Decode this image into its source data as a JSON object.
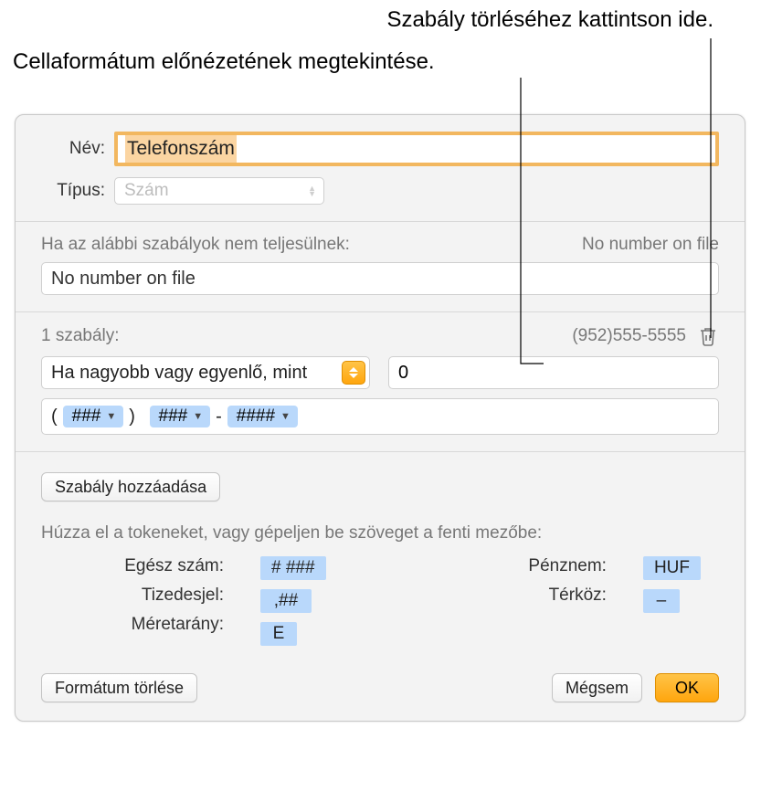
{
  "callouts": {
    "delete_rule": "Szabály törléséhez kattintson ide.",
    "preview": "Cellaformátum előnézetének megtekintése."
  },
  "labels": {
    "name": "Név:",
    "type": "Típus:"
  },
  "fields": {
    "name_value": "Telefonszám",
    "type_value": "Szám",
    "fallback_label": "Ha az alábbi szabályok nem teljesülnek:",
    "fallback_preview": "No number on file",
    "fallback_value": "No number on file",
    "rule_count_label": "1 szabály:",
    "rule_preview": "(952)555-5555",
    "condition": "Ha nagyobb vagy egyenlő, mint",
    "condition_value": "0"
  },
  "format_tokens": {
    "open": "(",
    "t1": "###",
    "close": ")",
    "t2": "###",
    "dash": "-",
    "t3": "####"
  },
  "buttons": {
    "add_rule": "Szabály hozzáadása",
    "delete_format": "Formátum törlése",
    "cancel": "Mégsem",
    "ok": "OK"
  },
  "tokens_help": "Húzza el a tokeneket, vagy gépeljen be szöveget a fenti mezőbe:",
  "tokens": {
    "integer_label": "Egész szám:",
    "integer": "# ###",
    "decimal_label": "Tizedesjel:",
    "decimal": ",##",
    "scale_label": "Méretarány:",
    "scale": "E",
    "currency_label": "Pénznem:",
    "currency": "HUF",
    "space_label": "Térköz:",
    "space": "–"
  }
}
